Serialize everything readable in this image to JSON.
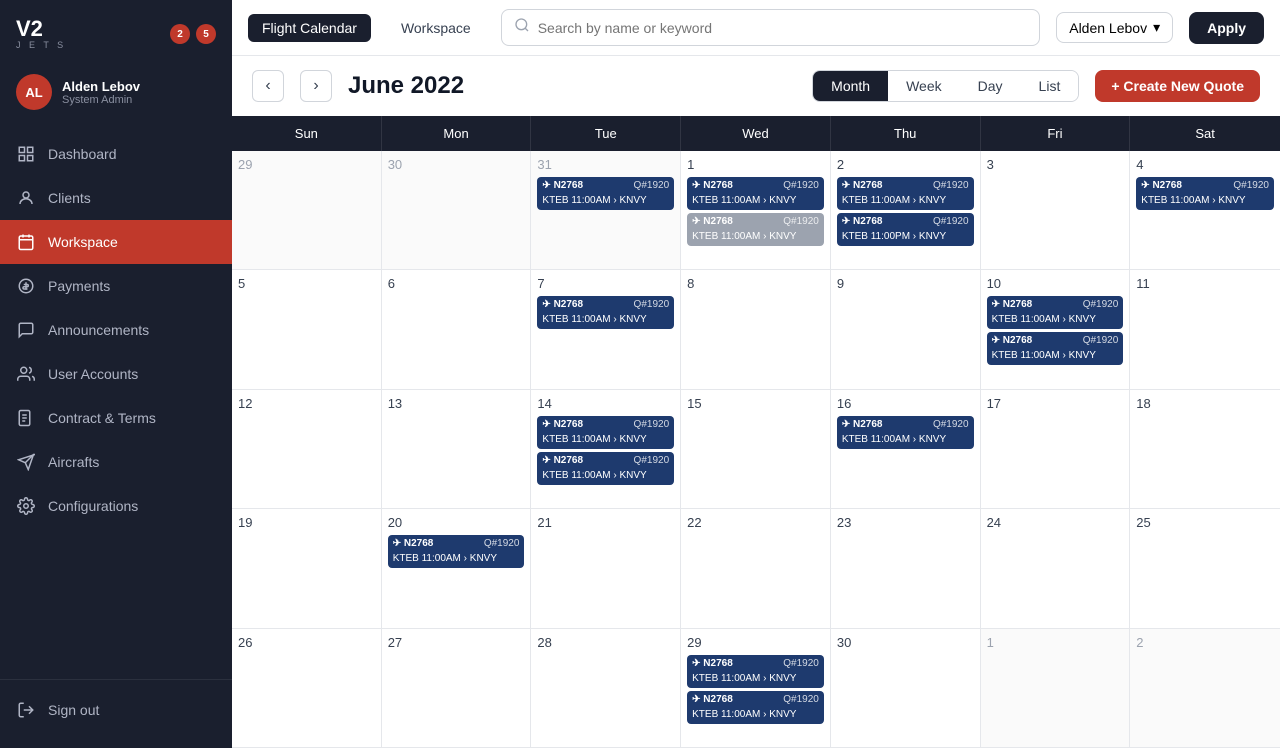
{
  "sidebar": {
    "logo": "V2",
    "logo_sub": "J E T S",
    "badge1": "2",
    "badge2": "5",
    "user": {
      "initials": "AL",
      "name": "Alden Lebov",
      "role": "System Admin"
    },
    "nav": [
      {
        "id": "dashboard",
        "label": "Dashboard",
        "icon": "grid"
      },
      {
        "id": "clients",
        "label": "Clients",
        "icon": "user"
      },
      {
        "id": "workspace",
        "label": "Workspace",
        "icon": "calendar",
        "active": true
      },
      {
        "id": "payments",
        "label": "Payments",
        "icon": "dollar"
      },
      {
        "id": "announcements",
        "label": "Announcements",
        "icon": "chat"
      },
      {
        "id": "user-accounts",
        "label": "User Accounts",
        "icon": "users"
      },
      {
        "id": "contract",
        "label": "Contract & Terms",
        "icon": "file"
      },
      {
        "id": "aircrafts",
        "label": "Aircrafts",
        "icon": "plane"
      },
      {
        "id": "configurations",
        "label": "Configurations",
        "icon": "gear"
      }
    ],
    "signout": "Sign out"
  },
  "header": {
    "tab_flight": "Flight Calendar",
    "tab_workspace": "Workspace",
    "search_placeholder": "Search by name or keyword",
    "user_dropdown": "Alden Lebov",
    "apply_btn": "Apply"
  },
  "calendar": {
    "title": "June 2022",
    "views": [
      "Month",
      "Week",
      "Day",
      "List"
    ],
    "active_view": "Month",
    "create_btn": "+ Create New Quote",
    "day_headers": [
      "Sun",
      "Mon",
      "Tue",
      "Wed",
      "Thu",
      "Fri",
      "Sat"
    ],
    "weeks": [
      {
        "days": [
          {
            "num": "29",
            "other": true,
            "events": []
          },
          {
            "num": "30",
            "other": true,
            "events": []
          },
          {
            "num": "31",
            "other": true,
            "events": [
              {
                "type": "blue",
                "num": "N2768",
                "quote": "Q#1920",
                "route": "KTEB 11:00AM › KNVY"
              }
            ]
          },
          {
            "num": "1",
            "events": [
              {
                "type": "blue",
                "num": "N2768",
                "quote": "Q#1920",
                "route": "KTEB 11:00AM › KNVY"
              },
              {
                "type": "gray",
                "num": "N2768",
                "quote": "Q#1920",
                "route": "KTEB 11:00AM › KNVY"
              }
            ]
          },
          {
            "num": "2",
            "events": [
              {
                "type": "blue",
                "num": "N2768",
                "quote": "Q#1920",
                "route": "KTEB 11:00AM › KNVY"
              },
              {
                "type": "blue",
                "num": "N2768",
                "quote": "Q#1920",
                "route": "KTEB 11:00PM › KNVY"
              }
            ]
          },
          {
            "num": "3",
            "events": []
          },
          {
            "num": "4",
            "events": [
              {
                "type": "blue",
                "num": "N2768",
                "quote": "Q#1920",
                "route": "KTEB 11:00AM › KNVY"
              }
            ]
          }
        ]
      },
      {
        "days": [
          {
            "num": "5",
            "events": []
          },
          {
            "num": "6",
            "events": []
          },
          {
            "num": "7",
            "events": [
              {
                "type": "blue",
                "num": "N2768",
                "quote": "Q#1920",
                "route": "KTEB 11:00AM › KNVY"
              }
            ]
          },
          {
            "num": "8",
            "events": []
          },
          {
            "num": "9",
            "events": []
          },
          {
            "num": "10",
            "events": [
              {
                "type": "blue",
                "num": "N2768",
                "quote": "Q#1920",
                "route": "KTEB 11:00AM › KNVY"
              },
              {
                "type": "blue",
                "num": "N2768",
                "quote": "Q#1920",
                "route": "KTEB 11:00AM › KNVY"
              }
            ]
          },
          {
            "num": "11",
            "events": []
          }
        ]
      },
      {
        "days": [
          {
            "num": "12",
            "events": []
          },
          {
            "num": "13",
            "events": []
          },
          {
            "num": "14",
            "events": [
              {
                "type": "blue",
                "num": "N2768",
                "quote": "Q#1920",
                "route": "KTEB 11:00AM › KNVY"
              },
              {
                "type": "blue",
                "num": "N2768",
                "quote": "Q#1920",
                "route": "KTEB 11:00AM › KNVY"
              }
            ]
          },
          {
            "num": "15",
            "events": []
          },
          {
            "num": "16",
            "events": [
              {
                "type": "blue",
                "num": "N2768",
                "quote": "Q#1920",
                "route": "KTEB 11:00AM › KNVY"
              }
            ]
          },
          {
            "num": "17",
            "events": []
          },
          {
            "num": "18",
            "events": []
          }
        ]
      },
      {
        "days": [
          {
            "num": "19",
            "events": []
          },
          {
            "num": "20",
            "events": [
              {
                "type": "blue",
                "num": "N2768",
                "quote": "Q#1920",
                "route": "KTEB 11:00AM › KNVY"
              }
            ]
          },
          {
            "num": "21",
            "events": []
          },
          {
            "num": "22",
            "events": []
          },
          {
            "num": "23",
            "events": []
          },
          {
            "num": "24",
            "events": []
          },
          {
            "num": "25",
            "events": []
          }
        ]
      },
      {
        "days": [
          {
            "num": "26",
            "events": []
          },
          {
            "num": "27",
            "events": []
          },
          {
            "num": "28",
            "events": []
          },
          {
            "num": "29",
            "events": [
              {
                "type": "blue",
                "num": "N2768",
                "quote": "Q#1920",
                "route": "KTEB 11:00AM › KNVY"
              },
              {
                "type": "blue",
                "num": "N2768",
                "quote": "Q#1920",
                "route": "KTEB 11:00AM › KNVY"
              }
            ]
          },
          {
            "num": "30",
            "events": []
          },
          {
            "num": "1",
            "other": true,
            "events": []
          },
          {
            "num": "2",
            "other": true,
            "events": []
          }
        ]
      }
    ]
  }
}
